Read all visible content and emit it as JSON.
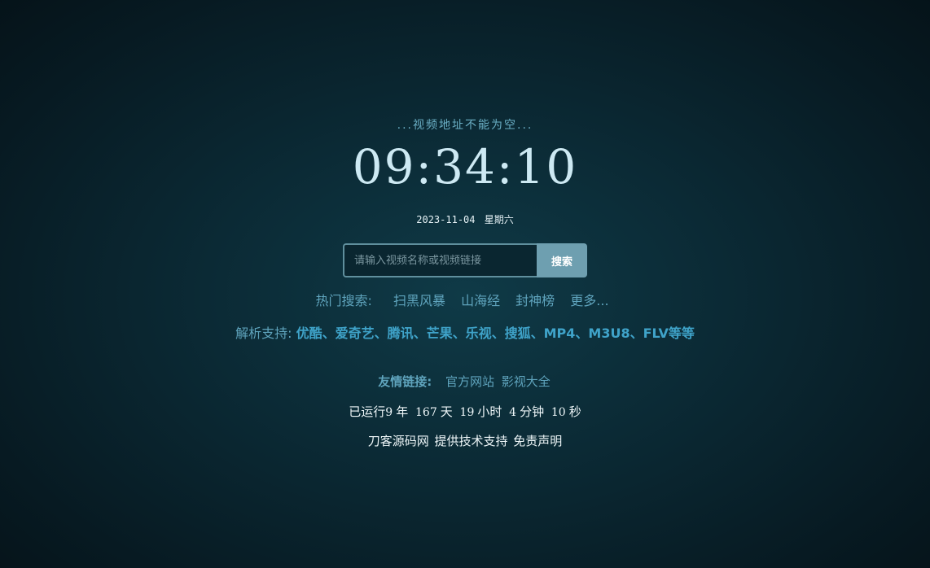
{
  "notice": "...视频地址不能为空...",
  "clock": "09:34:10",
  "date": {
    "day": "2023-11-04",
    "weekday": "星期六"
  },
  "search": {
    "placeholder": "请输入视频名称或视频链接",
    "value": "",
    "button": "搜索"
  },
  "hot_search": {
    "label": "热门搜索:",
    "items": [
      "扫黑风暴",
      "山海经",
      "封神榜"
    ],
    "more": "更多..."
  },
  "support": {
    "label": "解析支持:",
    "list": "优酷、爱奇艺、腾讯、芒果、乐视、搜狐、MP4、M3U8、FLV等等"
  },
  "friend_links": {
    "label": "友情链接:",
    "items": [
      "官方网站",
      "影视大全"
    ]
  },
  "runtime": {
    "prefix": "已运行",
    "years": "9",
    "years_unit": "年",
    "days": "167",
    "days_unit": "天",
    "hours": "19",
    "hours_unit": "小时",
    "minutes": "4",
    "minutes_unit": "分钟",
    "seconds": "10",
    "seconds_unit": "秒"
  },
  "footer": {
    "site": "刀客源码网",
    "text": "提供技术支持",
    "disclaimer": "免责声明"
  }
}
